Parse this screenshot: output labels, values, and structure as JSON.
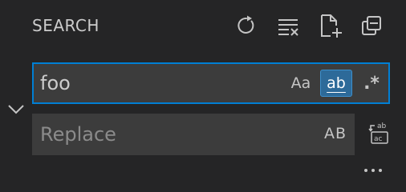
{
  "header": {
    "title": "SEARCH",
    "actions": [
      {
        "icon": "refresh-icon"
      },
      {
        "icon": "clear-results-icon"
      },
      {
        "icon": "new-search-editor-icon"
      },
      {
        "icon": "collapse-all-icon"
      }
    ]
  },
  "search": {
    "value": "foo",
    "options": {
      "match_case": "Aa",
      "match_whole_word": "ab",
      "use_regex": ".*"
    },
    "whole_word_active": true
  },
  "replace": {
    "placeholder": "Replace",
    "preserve_case": "AB",
    "replace_all_icon": "replace-all-icon",
    "expanded": true
  },
  "more_icon": "ellipsis-icon",
  "colors": {
    "background": "#252526",
    "input_bg": "#3c3c3c",
    "focus_border": "#007fd4",
    "active_option_bg": "#2d6a99"
  }
}
